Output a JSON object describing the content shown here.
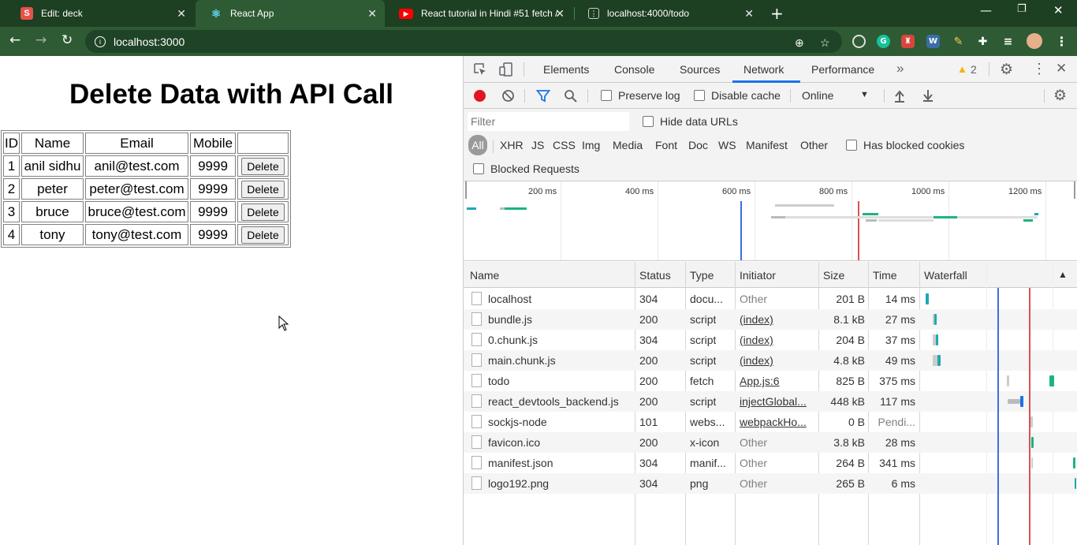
{
  "browser": {
    "tabs": [
      {
        "title": "Edit: deck",
        "favicon": "S",
        "favicon_color": "#e8514a"
      },
      {
        "title": "React App",
        "favicon": "⚛",
        "favicon_color": "#2e5b33"
      },
      {
        "title": "React tutorial in Hindi #51 fetch /",
        "favicon": "▶",
        "favicon_color": "#ff0000"
      },
      {
        "title": "localhost:4000/todo",
        "favicon": "◫",
        "favicon_color": "#1d3f22"
      }
    ],
    "url": "localhost:3000"
  },
  "page": {
    "heading": "Delete Data with API Call",
    "columns": [
      "ID",
      "Name",
      "Email",
      "Mobile"
    ],
    "rows": [
      {
        "id": "1",
        "name": "anil sidhu",
        "email": "anil@test.com",
        "mobile": "9999",
        "action": "Delete"
      },
      {
        "id": "2",
        "name": "peter",
        "email": "peter@test.com",
        "mobile": "9999",
        "action": "Delete"
      },
      {
        "id": "3",
        "name": "bruce",
        "email": "bruce@test.com",
        "mobile": "9999",
        "action": "Delete"
      },
      {
        "id": "4",
        "name": "tony",
        "email": "tony@test.com",
        "mobile": "9999",
        "action": "Delete"
      }
    ]
  },
  "devtools": {
    "tabs": [
      "Elements",
      "Console",
      "Sources",
      "Network",
      "Performance"
    ],
    "active_tab": "Network",
    "warnings": "2",
    "toolbar": {
      "preserve_log": "Preserve log",
      "disable_cache": "Disable cache",
      "throttle": "Online"
    },
    "filter": {
      "placeholder": "Filter",
      "hide_data_urls": "Hide data URLs",
      "types": [
        "All",
        "XHR",
        "JS",
        "CSS",
        "Img",
        "Media",
        "Font",
        "Doc",
        "WS",
        "Manifest",
        "Other"
      ],
      "has_blocked_cookies": "Has blocked cookies",
      "blocked_requests": "Blocked Requests"
    },
    "overview_ticks": [
      "200 ms",
      "400 ms",
      "600 ms",
      "800 ms",
      "1000 ms",
      "1200 ms"
    ],
    "columns": [
      "Name",
      "Status",
      "Type",
      "Initiator",
      "Size",
      "Time",
      "Waterfall"
    ],
    "requests": [
      {
        "name": "localhost",
        "status": "304",
        "type": "docu...",
        "initiator": "Other",
        "size": "201 B",
        "time": "14 ms"
      },
      {
        "name": "bundle.js",
        "status": "200",
        "type": "script",
        "initiator": "(index)",
        "size": "8.1 kB",
        "time": "27 ms"
      },
      {
        "name": "0.chunk.js",
        "status": "304",
        "type": "script",
        "initiator": "(index)",
        "size": "204 B",
        "time": "37 ms"
      },
      {
        "name": "main.chunk.js",
        "status": "200",
        "type": "script",
        "initiator": "(index)",
        "size": "4.8 kB",
        "time": "49 ms"
      },
      {
        "name": "todo",
        "status": "200",
        "type": "fetch",
        "initiator": "App.js:6",
        "size": "825 B",
        "time": "375 ms"
      },
      {
        "name": "react_devtools_backend.js",
        "status": "200",
        "type": "script",
        "initiator": "injectGlobal...",
        "size": "448 kB",
        "time": "117 ms"
      },
      {
        "name": "sockjs-node",
        "status": "101",
        "type": "webs...",
        "initiator": "webpackHo...",
        "size": "0 B",
        "time": "Pendi..."
      },
      {
        "name": "favicon.ico",
        "status": "200",
        "type": "x-icon",
        "initiator": "Other",
        "size": "3.8 kB",
        "time": "28 ms"
      },
      {
        "name": "manifest.json",
        "status": "304",
        "type": "manif...",
        "initiator": "Other",
        "size": "264 B",
        "time": "341 ms"
      },
      {
        "name": "logo192.png",
        "status": "304",
        "type": "png",
        "initiator": "Other",
        "size": "265 B",
        "time": "6 ms"
      }
    ]
  }
}
